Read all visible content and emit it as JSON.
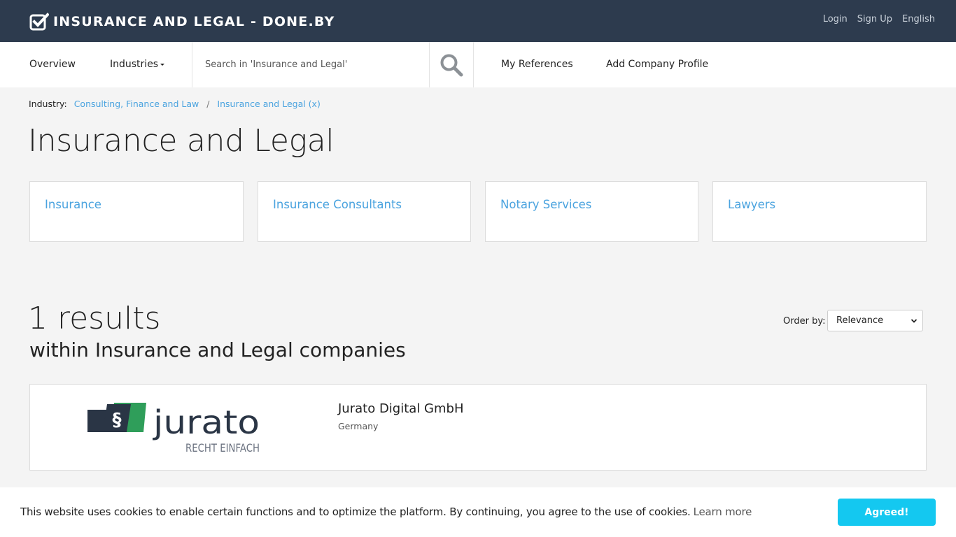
{
  "header": {
    "brand": "INSURANCE AND LEGAL - DONE.BY",
    "links": {
      "login": "Login",
      "signup": "Sign Up",
      "language": "English"
    }
  },
  "nav": {
    "overview": "Overview",
    "industries": "Industries",
    "search_placeholder": "Search in 'Insurance and Legal'",
    "my_references": "My References",
    "add_company": "Add Company Profile"
  },
  "breadcrumb": {
    "label": "Industry:",
    "items": [
      "Consulting, Finance and Law",
      "Insurance and Legal (x)"
    ],
    "separator": "/"
  },
  "page": {
    "title": "Insurance and Legal",
    "categories": [
      "Insurance",
      "Insurance Consultants",
      "Notary Services",
      "Lawyers"
    ]
  },
  "results": {
    "count": "1 results",
    "subtitle": "within Insurance and Legal companies",
    "order_label": "Order by:",
    "order_value": "Relevance",
    "items": [
      {
        "name": "Jurato Digital GmbH",
        "country": "Germany",
        "logo_text": "jurato",
        "logo_tagline": "RECHT EINFACH",
        "logo_symbol": "§"
      }
    ]
  },
  "cookie": {
    "text": "This website uses cookies to enable certain functions and to optimize the platform. By continuing, you agree to the use of cookies.",
    "learn_more": "Learn more",
    "button": "Agreed!"
  },
  "colors": {
    "topbar": "#2d3b4e",
    "link": "#4aa3df",
    "cookie_button": "#14c8f0",
    "logo_green": "#2f9e5a",
    "logo_dark": "#2a3545"
  }
}
